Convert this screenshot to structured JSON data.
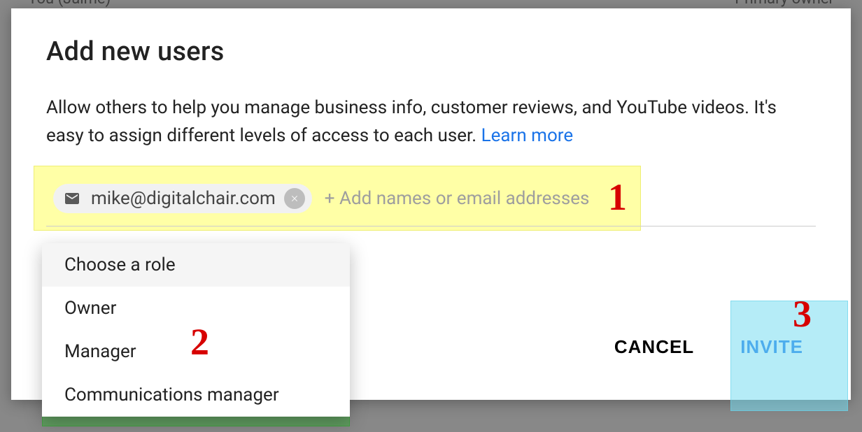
{
  "backdrop": {
    "left_partial": "You (Jaime)",
    "right_partial": "Primary owner"
  },
  "modal": {
    "title": "Add new users",
    "description": "Allow others to help you manage business info, customer reviews, and YouTube videos. It's easy to assign different levels of access to each user. ",
    "learn_more": "Learn more",
    "chip_email": "mike@digitalchair.com",
    "input_placeholder": "+ Add names or email addresses",
    "role_header": "Choose a role",
    "roles": {
      "owner": "Owner",
      "manager": "Manager",
      "comms": "Communications manager"
    },
    "cancel": "CANCEL",
    "invite": "INVITE"
  },
  "annotations": {
    "n1": "1",
    "n2": "2",
    "n3": "3"
  }
}
